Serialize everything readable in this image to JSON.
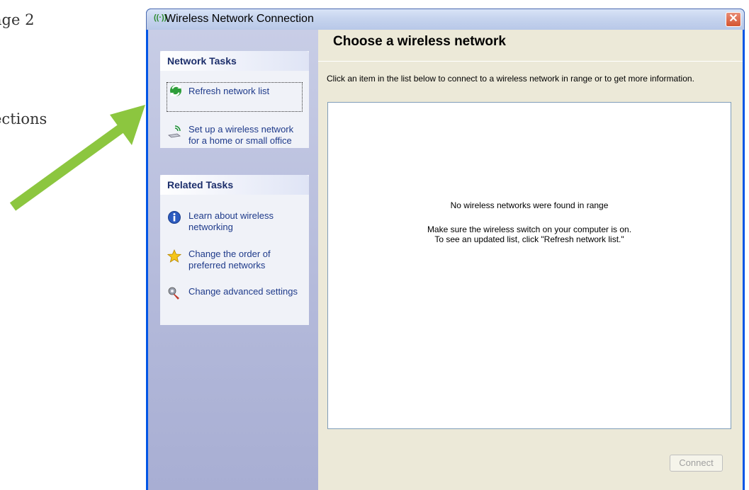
{
  "document": {
    "page_fragment": "age 2",
    "sections_fragment": "ections"
  },
  "window": {
    "title": "Wireless Network Connection",
    "close_symbol": "✕"
  },
  "network_tasks": {
    "header": "Network Tasks",
    "items": [
      {
        "label": "Refresh network list",
        "icon": "refresh-icon"
      },
      {
        "label": "Set up a wireless network for a home or small office",
        "icon": "wireless-setup-icon"
      }
    ]
  },
  "related_tasks": {
    "header": "Related Tasks",
    "items": [
      {
        "label": "Learn about wireless networking",
        "icon": "info-icon"
      },
      {
        "label": "Change the order of preferred networks",
        "icon": "star-icon"
      },
      {
        "label": "Change advanced settings",
        "icon": "settings-icon"
      }
    ]
  },
  "main": {
    "heading": "Choose a wireless network",
    "intro": "Click an item in the list below to connect to a wireless network in range or to get more information.",
    "empty_title": "No wireless networks were found in range",
    "empty_hint_line1": "Make sure the wireless switch on your computer is on.",
    "empty_hint_line2": "To see an updated list, click \"Refresh network list.\"",
    "connect_label": "Connect"
  },
  "colors": {
    "arrow": "#8cc63f",
    "window_frame": "#0055e5"
  }
}
